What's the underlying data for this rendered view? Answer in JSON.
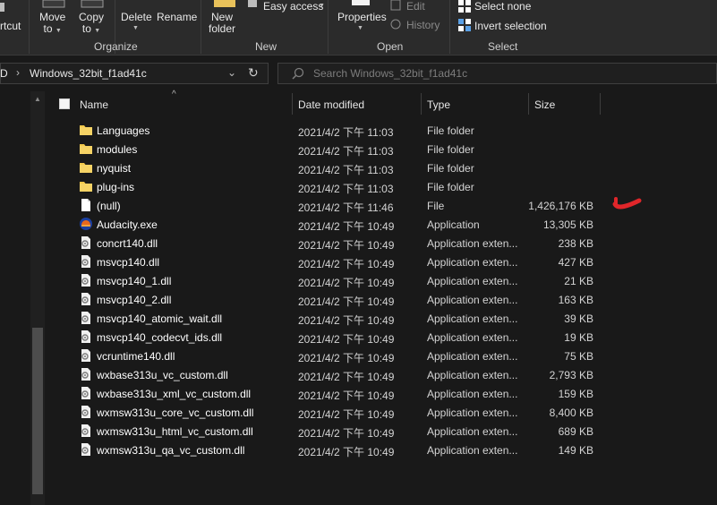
{
  "ribbon": {
    "shortcut_label": "rtcut",
    "move_to_label": "Move\nto",
    "copy_to_label": "Copy\nto",
    "delete_label": "Delete",
    "rename_label": "Rename",
    "new_folder_label": "New\nfolder",
    "easy_access_label": "Easy access",
    "properties_label": "Properties",
    "edit_label": "Edit",
    "history_label": "History",
    "select_none_label": "Select none",
    "invert_selection_label": "Invert selection",
    "groups": {
      "organize": "Organize",
      "new": "New",
      "open": "Open",
      "select": "Select"
    }
  },
  "address": {
    "prefix": "D",
    "folder": "Windows_32bit_f1ad41c",
    "search_placeholder": "Search Windows_32bit_f1ad41c"
  },
  "columns": {
    "name": "Name",
    "date_modified": "Date modified",
    "type": "Type",
    "size": "Size"
  },
  "files": [
    {
      "name": "Languages",
      "date": "2021/4/2 下午 11:03",
      "type": "File folder",
      "size": "",
      "icon": "folder-icon"
    },
    {
      "name": "modules",
      "date": "2021/4/2 下午 11:03",
      "type": "File folder",
      "size": "",
      "icon": "folder-icon"
    },
    {
      "name": "nyquist",
      "date": "2021/4/2 下午 11:03",
      "type": "File folder",
      "size": "",
      "icon": "folder-icon"
    },
    {
      "name": "plug-ins",
      "date": "2021/4/2 下午 11:03",
      "type": "File folder",
      "size": "",
      "icon": "folder-icon"
    },
    {
      "name": "(null)",
      "date": "2021/4/2 下午 11:46",
      "type": "File",
      "size": "1,426,176 KB",
      "icon": "file-icon"
    },
    {
      "name": "Audacity.exe",
      "date": "2021/4/2 下午 10:49",
      "type": "Application",
      "size": "13,305 KB",
      "icon": "audacity-icon"
    },
    {
      "name": "concrt140.dll",
      "date": "2021/4/2 下午 10:49",
      "type": "Application exten...",
      "size": "238 KB",
      "icon": "dll-icon"
    },
    {
      "name": "msvcp140.dll",
      "date": "2021/4/2 下午 10:49",
      "type": "Application exten...",
      "size": "427 KB",
      "icon": "dll-icon"
    },
    {
      "name": "msvcp140_1.dll",
      "date": "2021/4/2 下午 10:49",
      "type": "Application exten...",
      "size": "21 KB",
      "icon": "dll-icon"
    },
    {
      "name": "msvcp140_2.dll",
      "date": "2021/4/2 下午 10:49",
      "type": "Application exten...",
      "size": "163 KB",
      "icon": "dll-icon"
    },
    {
      "name": "msvcp140_atomic_wait.dll",
      "date": "2021/4/2 下午 10:49",
      "type": "Application exten...",
      "size": "39 KB",
      "icon": "dll-icon"
    },
    {
      "name": "msvcp140_codecvt_ids.dll",
      "date": "2021/4/2 下午 10:49",
      "type": "Application exten...",
      "size": "19 KB",
      "icon": "dll-icon"
    },
    {
      "name": "vcruntime140.dll",
      "date": "2021/4/2 下午 10:49",
      "type": "Application exten...",
      "size": "75 KB",
      "icon": "dll-icon"
    },
    {
      "name": "wxbase313u_vc_custom.dll",
      "date": "2021/4/2 下午 10:49",
      "type": "Application exten...",
      "size": "2,793 KB",
      "icon": "dll-icon"
    },
    {
      "name": "wxbase313u_xml_vc_custom.dll",
      "date": "2021/4/2 下午 10:49",
      "type": "Application exten...",
      "size": "159 KB",
      "icon": "dll-icon"
    },
    {
      "name": "wxmsw313u_core_vc_custom.dll",
      "date": "2021/4/2 下午 10:49",
      "type": "Application exten...",
      "size": "8,400 KB",
      "icon": "dll-icon"
    },
    {
      "name": "wxmsw313u_html_vc_custom.dll",
      "date": "2021/4/2 下午 10:49",
      "type": "Application exten...",
      "size": "689 KB",
      "icon": "dll-icon"
    },
    {
      "name": "wxmsw313u_qa_vc_custom.dll",
      "date": "2021/4/2 下午 10:49",
      "type": "Application exten...",
      "size": "149 KB",
      "icon": "dll-icon"
    }
  ],
  "colors": {
    "background": "#191919",
    "ribbon": "#2b2b2b",
    "folder": "#f2c84b",
    "annotation": "#e0262a"
  }
}
